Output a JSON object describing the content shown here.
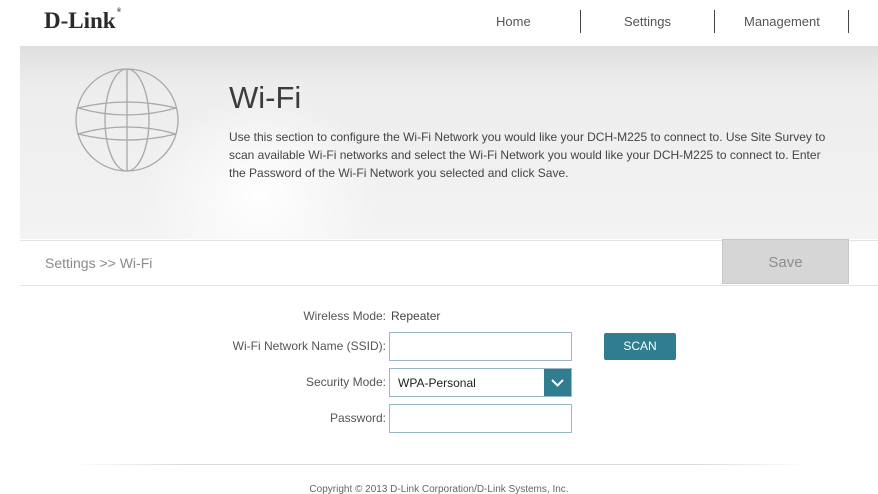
{
  "brand": {
    "logo": "D-Link",
    "logo_mark": "®"
  },
  "nav": {
    "home": "Home",
    "settings": "Settings",
    "management": "Management"
  },
  "page": {
    "title": "Wi-Fi",
    "description": "Use this section to configure the Wi-Fi Network you would like your DCH-M225 to connect to. Use Site Survey to scan available Wi-Fi networks and select the Wi-Fi Network you would like your DCH-M225 to connect to. Enter the Password of the Wi-Fi Network you selected and click Save.",
    "globe_icon": "globe-icon"
  },
  "breadcrumb": "Settings >> Wi-Fi",
  "save_label": "Save",
  "form": {
    "wireless_mode_label": "Wireless Mode:",
    "wireless_mode_value": "Repeater",
    "ssid_label": "Wi-Fi Network Name (SSID):",
    "ssid_value": "",
    "scan_label": "SCAN",
    "security_mode_label": "Security Mode:",
    "security_mode_value": "WPA-Personal",
    "password_label": "Password:",
    "password_value": ""
  },
  "footer": "Copyright © 2013 D-Link Corporation/D-Link Systems, Inc.",
  "colors": {
    "accent": "#2f7d8e",
    "save_bg": "#d6d6d6",
    "input_border": "#9ab8c4"
  }
}
